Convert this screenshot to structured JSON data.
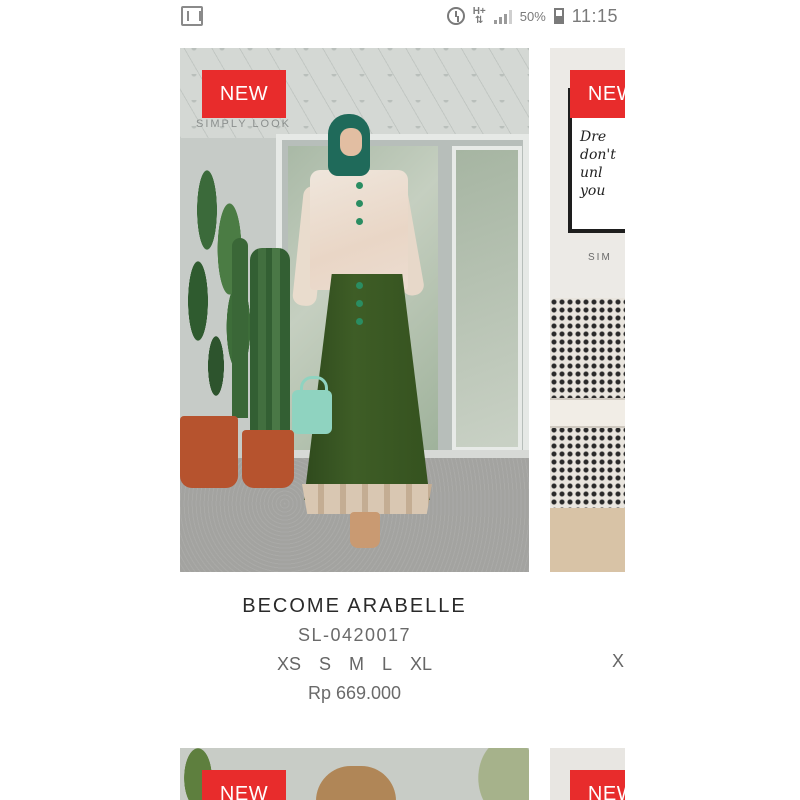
{
  "status_bar": {
    "left_icon": "gallery-icon",
    "network": "H+",
    "battery_percent": "50%",
    "battery_level": 0.5,
    "time": "11:15"
  },
  "products": [
    {
      "badge": "NEW",
      "name": "BECOME ARABELLE",
      "sku": "SL-0420017",
      "sizes": [
        "XS",
        "S",
        "M",
        "L",
        "XL"
      ],
      "price": "Rp 669.000",
      "watermark": "SIMPLY LOOK"
    },
    {
      "badge": "NEW",
      "size_peek": "XS",
      "frame_text": "Dre don't unl you"
    },
    {
      "badge": "NEW"
    },
    {
      "badge": "NEW"
    }
  ],
  "colors": {
    "badge": "#e82c2c",
    "text": "#2a2a2a",
    "muted": "#6a6a6a",
    "background": "#ffffff"
  }
}
